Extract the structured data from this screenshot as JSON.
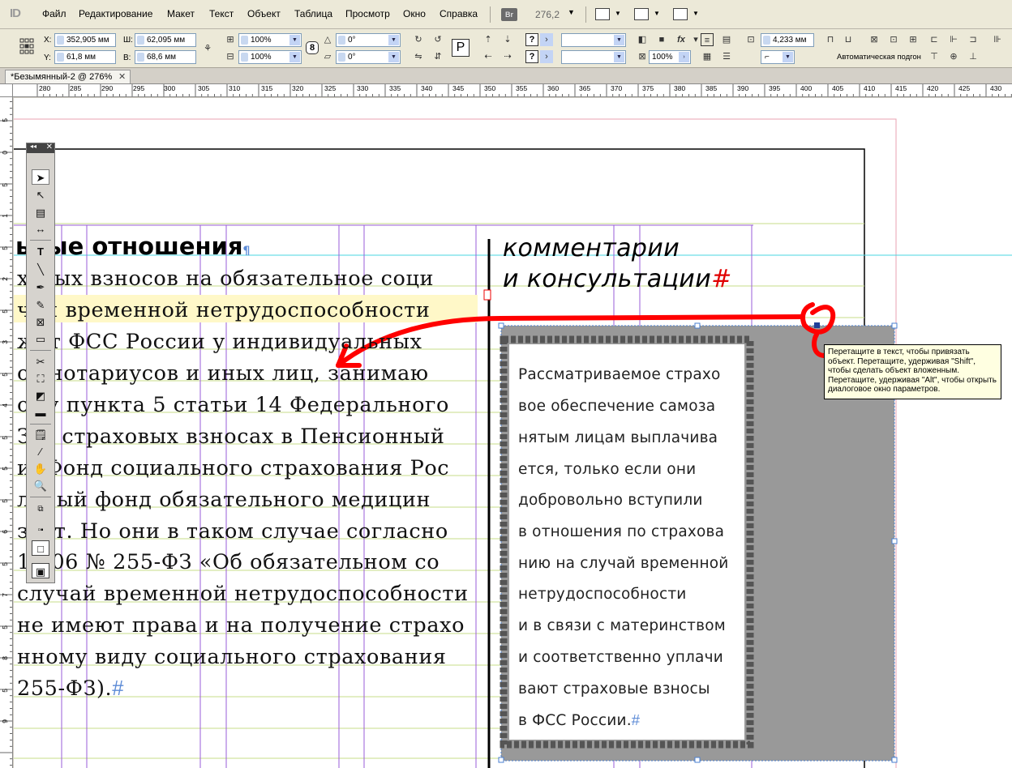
{
  "menubar": {
    "app_logo": "ID",
    "items": [
      "Файл",
      "Редактирование",
      "Макет",
      "Текст",
      "Объект",
      "Таблица",
      "Просмотр",
      "Окно",
      "Справка"
    ],
    "bridge_label": "Br",
    "zoom": "276,2"
  },
  "control": {
    "x_label": "X:",
    "x_value": "352,905 мм",
    "y_label": "Y:",
    "y_value": "61,8 мм",
    "w_label": "Ш:",
    "w_value": "62,095 мм",
    "h_label": "В:",
    "h_value": "68,6 мм",
    "scale_x": "100%",
    "scale_y": "100%",
    "rotate": "0°",
    "shear": "0°",
    "opacity": "100%",
    "stroke_weight": "4,233 мм",
    "autofit_label": "Автоматическая подгон"
  },
  "tab": {
    "title": "*Безымянный-2 @ 276%"
  },
  "ruler": {
    "h_labels": [
      "280",
      "285",
      "290",
      "295",
      "300",
      "305",
      "310",
      "315",
      "320",
      "325",
      "330",
      "335",
      "340",
      "345",
      "350",
      "355",
      "360",
      "365",
      "370",
      "375",
      "380",
      "385",
      "390",
      "395",
      "400",
      "405",
      "410",
      "415",
      "420",
      "425",
      "430"
    ],
    "v_labels": [
      "5",
      "0",
      "5",
      "1",
      "5",
      "2",
      "5",
      "3",
      "5",
      "4",
      "5",
      "5",
      "5",
      "6",
      "5",
      "7",
      "5",
      "8",
      "5",
      "9"
    ]
  },
  "document": {
    "heading": "ьные отношения",
    "body_lines": [
      "ховых взносов на обязательное соци",
      "чай временной нетрудоспособности",
      "жет ФСС России у индивидуальных",
      "ов нотариусов и иных лиц, занимаю",
      "ому пункта 5 статьи 14 Федерального",
      "З О страховых взносах в Пенсионный",
      "и, Фонд социального страхования Рос",
      "льный фонд обязательного медицин",
      "зует. Но они в таком случае согласно",
      "12.06 № 255-ФЗ «Об обязательном со",
      "случай временной нетрудоспособности",
      "не имеют права и на получение страхо",
      "нному виду социального страхования",
      "255-ФЗ)."
    ],
    "comment_title_1": "комментарии",
    "comment_title_2": "и консультации",
    "box_lines": [
      "Рассматриваемое страхо",
      "вое обеспечение самоза",
      "нятым лицам выплачива",
      "ется, только если они",
      "добровольно вступили",
      "в отношения по страхова",
      "нию на случай временной",
      "нетрудоспособности",
      "и в связи с материнством",
      "и соответственно уплачи",
      "вают страховые взносы",
      "в ФСС России."
    ],
    "hash_mark": "#",
    "tooltip": "Перетащите в текст, чтобы привязать объект. Перетащите, удерживая \"Shift\", чтобы сделать объект вложенным. Перетащите, удерживая \"Alt\", чтобы открыть диалоговое окно параметров."
  },
  "colors": {
    "ui_bg": "#ece9d8",
    "guide_purple": "#8a4bd6",
    "guide_green": "#b6d36a",
    "guide_cyan": "#48d6e0",
    "margin_red": "#e0607a",
    "annotation_red": "#ff0000",
    "highlight": "#fff8c8",
    "frame_gray": "#999999"
  }
}
